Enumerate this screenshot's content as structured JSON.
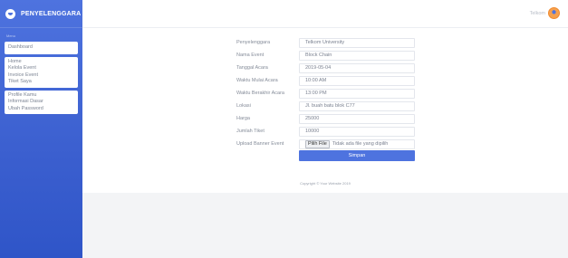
{
  "sidebar": {
    "brand": "PENYELENGGARA",
    "menu_label": "Menu",
    "group1": [
      "Dashboard"
    ],
    "group2": [
      "Home",
      "Kelola Event",
      "Invoice Event",
      "Tiket Saya"
    ],
    "group3": [
      "Profile Kamu",
      "Informasi Dasar",
      "Ubah Password"
    ]
  },
  "topbar": {
    "user_name": "Telkom"
  },
  "form": {
    "rows": [
      {
        "label": "Penyelenggara",
        "value": "Telkom University"
      },
      {
        "label": "Nama Event",
        "value": "Block Chain"
      },
      {
        "label": "Tanggal Acara",
        "value": "2019-05-04"
      },
      {
        "label": "Waktu Mulai Acara",
        "value": "10:00 AM"
      },
      {
        "label": "Waktu Berakhir Acara",
        "value": "13:00 PM"
      },
      {
        "label": "Lokasi",
        "value": "Jl. buah batu blok C77"
      },
      {
        "label": "Harga",
        "value": "25000"
      },
      {
        "label": "Jumlah Tiket",
        "value": "10000"
      }
    ],
    "upload_label": "Upload Banner Event",
    "file_button": "Pilih File",
    "file_status": "Tidak ada file yang dipilih",
    "save_label": "Simpan"
  },
  "footer": {
    "text": "Copyright © Your Website 2019"
  },
  "colors": {
    "primary": "#4e73df",
    "avatar": "#f6a04d"
  }
}
